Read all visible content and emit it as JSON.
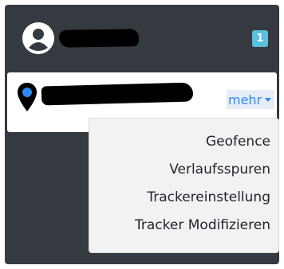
{
  "header": {
    "badge_count": "1",
    "avatar_icon": "user-circle-icon"
  },
  "tracker": {
    "pin_icon": "map-marker-icon",
    "more_label": "mehr",
    "more_icon": "caret-down-icon"
  },
  "menu": {
    "items": [
      {
        "label": "Geofence"
      },
      {
        "label": "Verlaufsspuren"
      },
      {
        "label": "Trackereinstellung"
      },
      {
        "label": "Tracker Modifizieren"
      }
    ]
  },
  "colors": {
    "panel_bg": "#343a40",
    "badge_bg": "#5bc0de",
    "link": "#2d89ef",
    "pin_dot": "#2d89ef"
  }
}
